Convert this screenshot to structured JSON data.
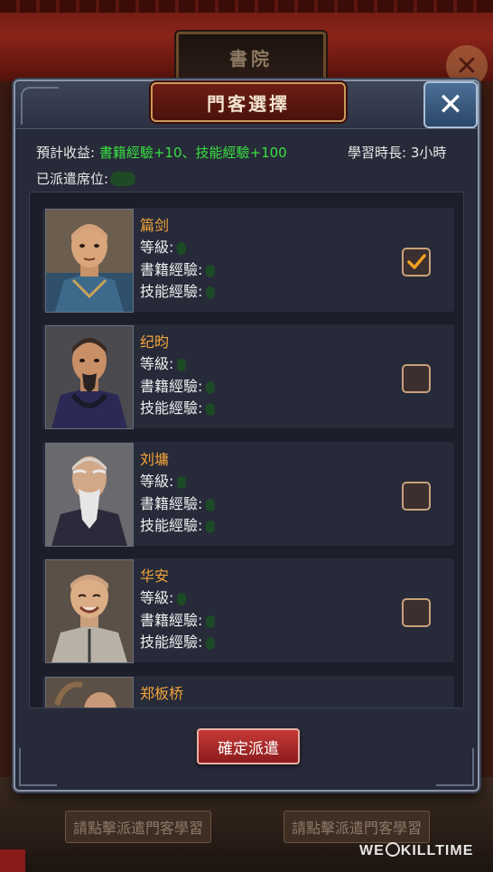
{
  "background": {
    "plaque_title": "書院",
    "hint_left": "請點擊派遣門客學習",
    "hint_right": "請點擊派遣門客學習",
    "watermark": "WEKILLTIME"
  },
  "dialog": {
    "title": "門客選擇",
    "close_label": "✕",
    "expected_label": "預計收益:",
    "expected_value": "書籍經驗+10、技能經驗+100",
    "duration_label": "學習時長:",
    "duration_value": "3小時",
    "dispatched_label": "已派遣席位:",
    "confirm_label": "確定派遣"
  },
  "stat_labels": {
    "level": "等級:",
    "book_exp": "書籍經驗:",
    "skill_exp": "技能經驗:"
  },
  "retainers": [
    {
      "name": "篇剑",
      "checked": true
    },
    {
      "name": "纪昀",
      "checked": false
    },
    {
      "name": "刘墉",
      "checked": false
    },
    {
      "name": "华安",
      "checked": false
    },
    {
      "name": "郑板桥",
      "checked": false
    }
  ],
  "colors": {
    "accent_green": "#38e043",
    "name_orange": "#f3a43a",
    "confirm_red": "#c53a38"
  }
}
